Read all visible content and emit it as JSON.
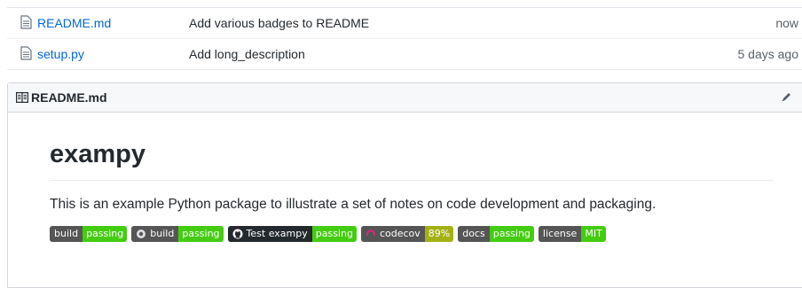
{
  "files": [
    {
      "name": "README.md",
      "message": "Add various badges to README",
      "age": "now"
    },
    {
      "name": "setup.py",
      "message": "Add long_description",
      "age": "5 days ago"
    }
  ],
  "readme": {
    "header_title": "README.md",
    "heading": "exampy",
    "paragraph": "This is an example Python package to illustrate a set of notes on code development and packaging.",
    "badges": [
      {
        "label": "build",
        "message": "passing",
        "message_color": "#4c1"
      },
      {
        "label": "build",
        "message": "passing",
        "message_color": "#4c1",
        "icon": "appveyor-icon"
      },
      {
        "label": "Test exampy",
        "message": "passing",
        "message_color": "#4c1",
        "label_color": "#24292e",
        "icon": "github-icon"
      },
      {
        "label": "codecov",
        "message": "89%",
        "message_color": "#a3b114",
        "icon": "codecov-icon"
      },
      {
        "label": "docs",
        "message": "passing",
        "message_color": "#4c1"
      },
      {
        "label": "license",
        "message": "MIT",
        "message_color": "#4c1"
      }
    ]
  },
  "colors": {
    "link": "#0366d6",
    "badge_label": "#555555"
  }
}
